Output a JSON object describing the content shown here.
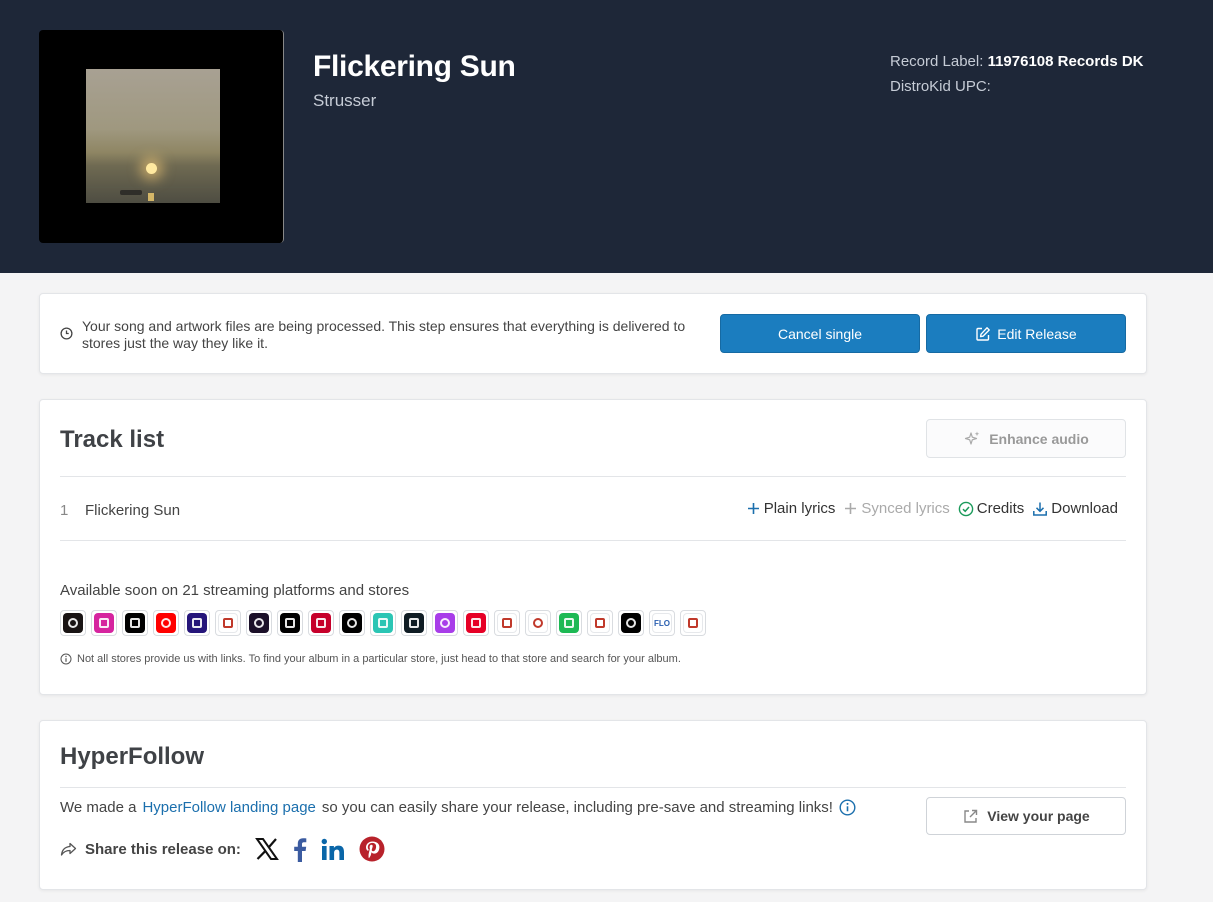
{
  "release": {
    "title": "Flickering Sun",
    "artist": "Strusser",
    "label_caption": "Record Label:",
    "label_value": "11976108 Records DK",
    "upc_caption": "DistroKid UPC:"
  },
  "processing": {
    "message": "Your song and artwork files are being processed. This step ensures that everything is delivered to stores just the way they like it.",
    "cancel_label": "Cancel single",
    "edit_label": "Edit Release"
  },
  "tracklist": {
    "title": "Track list",
    "enhance_label": "Enhance audio",
    "tracks": [
      {
        "number": "1",
        "name": "Flickering Sun"
      }
    ],
    "actions": {
      "plain_lyrics": "Plain lyrics",
      "synced_lyrics": "Synced lyrics",
      "credits": "Credits",
      "download": "Download"
    },
    "available_text": "Available soon on 21 streaming platforms and stores",
    "stores": [
      {
        "icon": "spotify-icon",
        "color": "#191414",
        "glyph": ""
      },
      {
        "icon": "instagram-icon",
        "color": "#d6249f",
        "glyph": ""
      },
      {
        "icon": "tiktok-icon",
        "color": "#010101",
        "glyph": ""
      },
      {
        "icon": "youtube-music-icon",
        "color": "#ff0000",
        "glyph": ""
      },
      {
        "icon": "amazon-music-icon",
        "color": "#25157a",
        "glyph": ""
      },
      {
        "icon": "pandora-icon",
        "color": "#ffffff",
        "glyph": ""
      },
      {
        "icon": "deezer-icon",
        "color": "#1b1029",
        "glyph": ""
      },
      {
        "icon": "tidal-icon",
        "color": "#000000",
        "glyph": ""
      },
      {
        "icon": "iheartradio-icon",
        "color": "#c6002b",
        "glyph": ""
      },
      {
        "icon": "qobuz-icon",
        "color": "#000000",
        "glyph": ""
      },
      {
        "icon": "jiosaavn-icon",
        "color": "#2bc5b4",
        "glyph": ""
      },
      {
        "icon": "boomplay-icon",
        "color": "#0f1c24",
        "glyph": ""
      },
      {
        "icon": "anghami-icon",
        "color": "#a83de9",
        "glyph": ""
      },
      {
        "icon": "netease-icon",
        "color": "#e60026",
        "glyph": ""
      },
      {
        "icon": "tencent-icon",
        "color": "#ffffff",
        "glyph": ""
      },
      {
        "icon": "kkbox-icon",
        "color": "#ffffff",
        "glyph": ""
      },
      {
        "icon": "audiomack-icon",
        "color": "#1db954",
        "glyph": ""
      },
      {
        "icon": "ximalaya-icon",
        "color": "#ffffff",
        "glyph": ""
      },
      {
        "icon": "adaptr-icon",
        "color": "#000000",
        "glyph": ""
      },
      {
        "icon": "flo-icon",
        "color": "#ffffff",
        "glyph": "FLO"
      },
      {
        "icon": "melon-icon",
        "color": "#ffffff",
        "glyph": ""
      }
    ],
    "stores_note": "Not all stores provide us with links. To find your album in a particular store, just head to that store and search for your album."
  },
  "hyperfollow": {
    "title": "HyperFollow",
    "text_before": "We made a",
    "link_text": "HyperFollow landing page",
    "text_after": "so you can easily share your release, including pre-save and streaming links!",
    "view_label": "View your page",
    "share_label": "Share this release on:",
    "social": [
      "x-icon",
      "facebook-icon",
      "linkedin-icon",
      "pinterest-icon"
    ]
  },
  "colors": {
    "header_bg": "#1e2738",
    "primary_button": "#1b7dbf",
    "link": "#1b6fad"
  }
}
